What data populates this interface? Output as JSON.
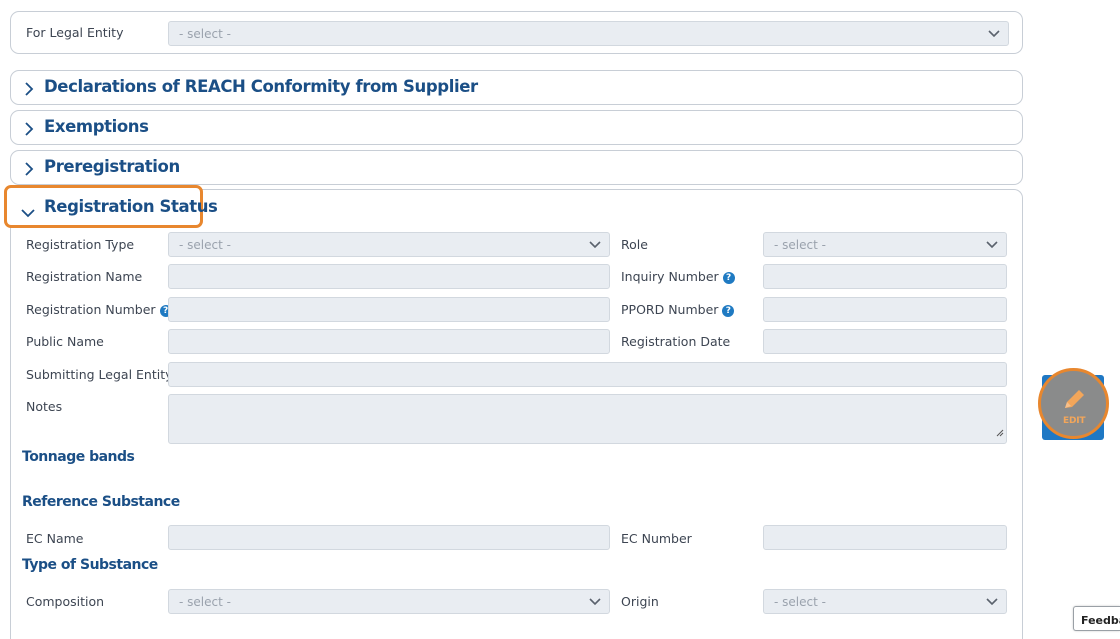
{
  "legal_entity": {
    "label": "For Legal Entity",
    "select_value": "- select -"
  },
  "accordion": {
    "declarations": "Declarations of REACH Conformity from Supplier",
    "exemptions": "Exemptions",
    "preregistration": "Preregistration",
    "registration_status": "Registration Status"
  },
  "registration": {
    "type_label": "Registration Type",
    "type_value": "- select -",
    "role_label": "Role",
    "role_value": "- select -",
    "name_label": "Registration Name",
    "inquiry_label": "Inquiry Number",
    "number_label": "Registration Number",
    "ppord_label": "PPORD Number",
    "public_name_label": "Public Name",
    "date_label": "Registration Date",
    "submitting_label": "Submitting Legal Entity",
    "notes_label": "Notes"
  },
  "sections": {
    "tonnage": "Tonnage bands",
    "reference": "Reference Substance",
    "type_substance": "Type of Substance"
  },
  "reference": {
    "ec_name_label": "EC Name",
    "ec_number_label": "EC Number"
  },
  "substance": {
    "composition_label": "Composition",
    "composition_value": "- select -",
    "origin_label": "Origin",
    "origin_value": "- select -"
  },
  "edit_button": {
    "label": "EDIT"
  },
  "feedback": {
    "label": "Feedba"
  },
  "colors": {
    "heading_blue": "#1b4f86",
    "highlight_orange": "#e8872e",
    "edit_blue": "#1f78c4",
    "help_blue": "#1f7ac2"
  },
  "icons": {
    "collapsed": "chevron-right-icon",
    "expanded": "chevron-down-icon",
    "help": "help-icon",
    "edit": "pencil-icon"
  }
}
